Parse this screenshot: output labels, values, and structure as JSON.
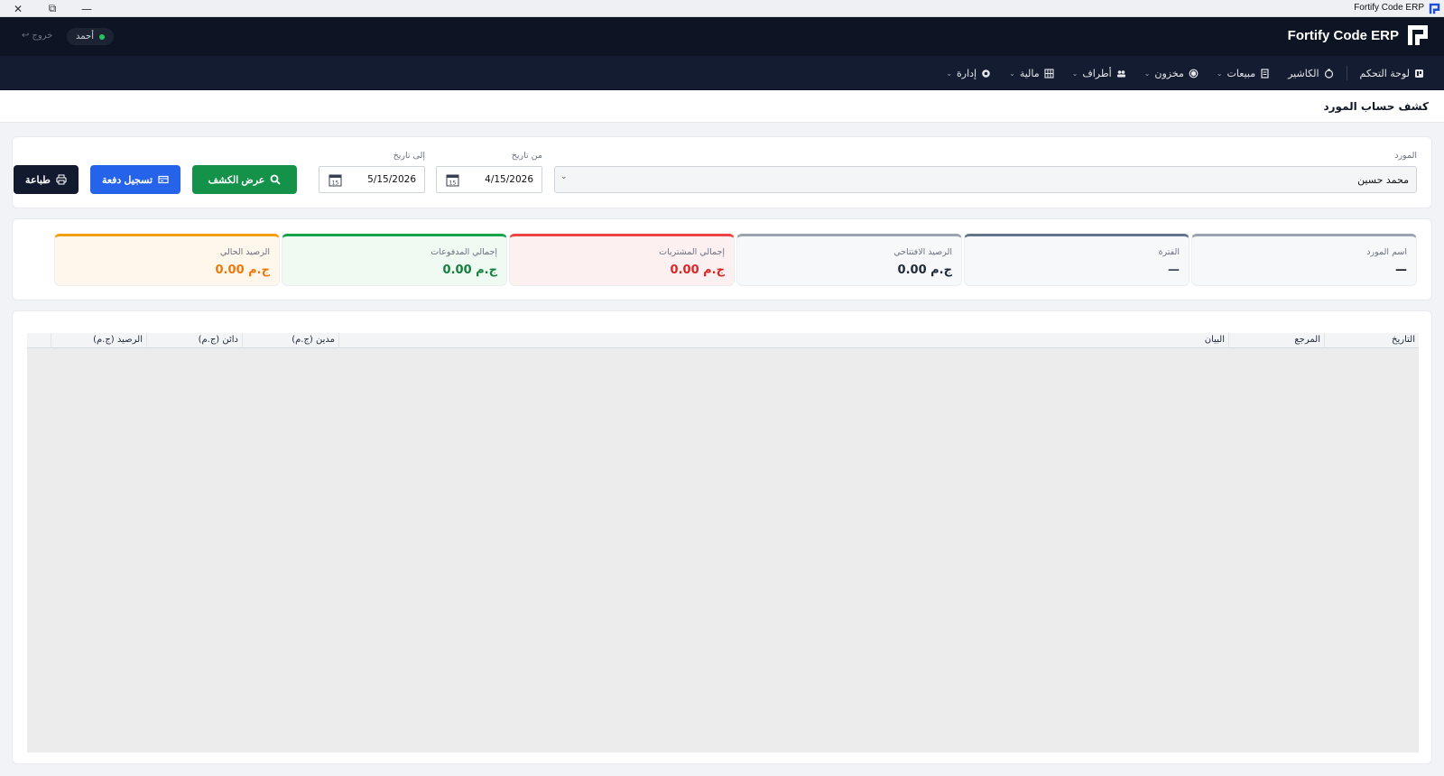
{
  "window": {
    "title": "Fortify Code ERP",
    "close_glyph": "✕",
    "restore_glyph": "⧉",
    "minimize_glyph": "—"
  },
  "header": {
    "brand": "Fortify Code ERP",
    "user_name": "أحمد",
    "logout_label": "خروج",
    "logout_glyph": "↩"
  },
  "nav": {
    "items": [
      {
        "label": "لوحة التحكم",
        "icon": "dashboard-icon",
        "caret": false
      },
      {
        "label": "الكاشير",
        "icon": "cashier-icon",
        "caret": false
      },
      {
        "label": "مبيعات",
        "icon": "sales-icon",
        "caret": true
      },
      {
        "label": "مخزون",
        "icon": "inventory-icon",
        "caret": true
      },
      {
        "label": "أطراف",
        "icon": "parties-icon",
        "caret": true
      },
      {
        "label": "مالية",
        "icon": "finance-icon",
        "caret": true
      },
      {
        "label": "إدارة",
        "icon": "admin-icon",
        "caret": true
      }
    ],
    "caret_glyph": "⌄"
  },
  "page": {
    "title": "كشف حساب المورد"
  },
  "filters": {
    "supplier_label": "المورد",
    "supplier_value": "محمد حسين",
    "from_label": "من تاريخ",
    "from_value": "4/15/2026",
    "to_label": "إلى تاريخ",
    "to_value": "5/15/2026",
    "show_button": "عرض الكشف",
    "payment_button": "تسجيل دفعة",
    "print_button": "طباعة"
  },
  "summary": [
    {
      "label": "اسم المورد",
      "value": "—",
      "color": "#9ca3af",
      "bg": "#f7f8fa",
      "valueColor": "#111827"
    },
    {
      "label": "الفترة",
      "value": "—",
      "color": "#64748b",
      "bg": "#f7f8fa",
      "valueColor": "#374151"
    },
    {
      "label": "الرصيد الافتتاحي",
      "value": "0.00 ج.م",
      "color": "#9ca3af",
      "bg": "#f7f8fa",
      "valueColor": "#1f2937"
    },
    {
      "label": "إجمالي المشتريات",
      "value": "0.00 ج.م",
      "color": "#ef4444",
      "bg": "#fdf0f0",
      "valueColor": "#dc2626"
    },
    {
      "label": "إجمالي المدفوعات",
      "value": "0.00 ج.م",
      "color": "#16a34a",
      "bg": "#effaf3",
      "valueColor": "#15803d"
    },
    {
      "label": "الرصيد الحالي",
      "value": "0.00 ج.م",
      "color": "#f59e0b",
      "bg": "#fff6ec",
      "valueColor": "#ea7a0c"
    }
  ],
  "table": {
    "columns": [
      "التاريخ",
      "المرجع",
      "البيان",
      "مدين (ج.م)",
      "دائن (ج.م)",
      "الرصيد (ج.م)"
    ],
    "rows": []
  }
}
